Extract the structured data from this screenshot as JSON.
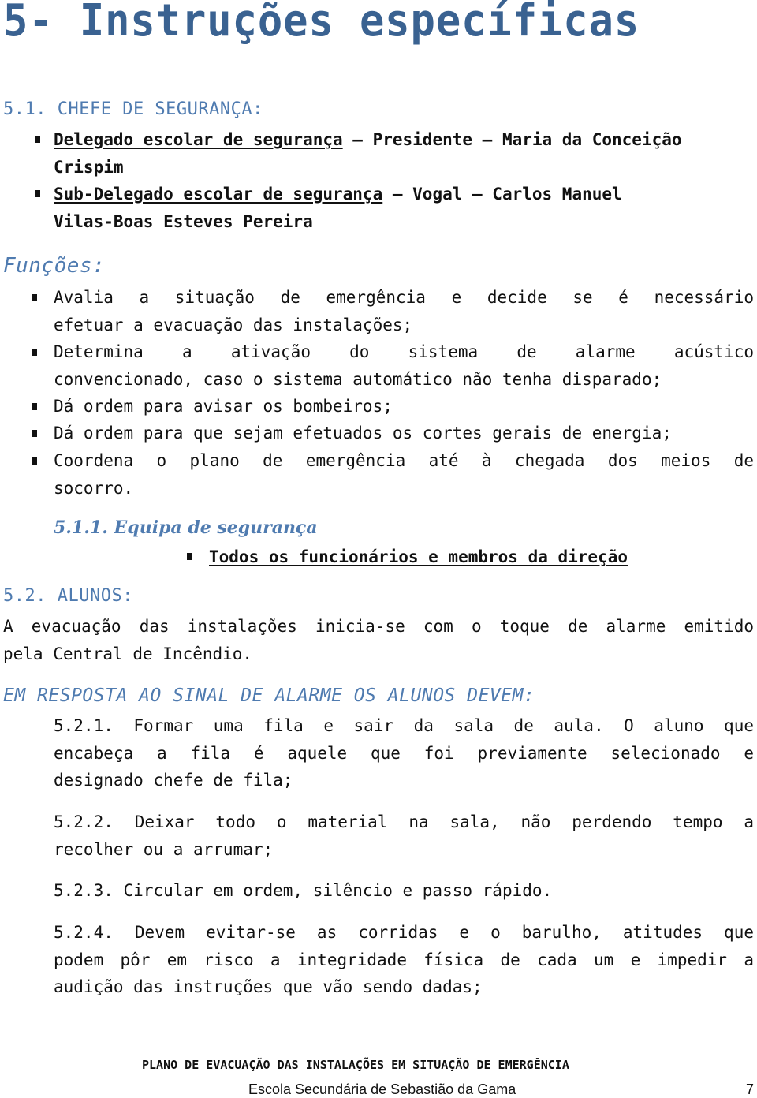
{
  "page_title": "5- Instruções específicas",
  "section_5_1": {
    "heading": "5.1. CHEFE DE SEGURANÇA:",
    "members": [
      {
        "role": "Delegado escolar de segurança",
        "rest_line1": " – Presidente – Maria da Conceição",
        "rest_line2": "Crispim"
      },
      {
        "role": "Sub-Delegado escolar de segurança",
        "rest_line1": " – Vogal – Carlos Manuel",
        "rest_line2": "Vilas-Boas Esteves Pereira"
      }
    ],
    "functions_heading": "Funções:",
    "functions": [
      {
        "line1": "Avalia a situação de emergência e decide se é necessário",
        "line2": "efetuar a evacuação das instalações;"
      },
      {
        "line1": "Determina a ativação do sistema de alarme acústico",
        "line2": "convencionado, caso o sistema automático não tenha disparado;"
      },
      {
        "line1": "Dá ordem para avisar os bombeiros;"
      },
      {
        "line1": "Dá ordem para que sejam efetuados os cortes gerais de energia;"
      },
      {
        "line1": "Coordena o plano de emergência até à chegada dos meios de",
        "line2": "socorro."
      }
    ],
    "subsection": {
      "heading": "5.1.1. Equipa de segurança",
      "item": "Todos os funcionários e membros da direção"
    }
  },
  "section_5_2": {
    "heading": "5.2. ALUNOS:",
    "intro_line1": "A evacuação das instalações inicia-se com o toque de alarme emitido",
    "intro_line2": "pela Central de Incêndio.",
    "response_heading": "EM RESPOSTA AO SINAL DE ALARME OS ALUNOS DEVEM:",
    "items": [
      {
        "lines": [
          "5.2.1. Formar uma fila e sair da sala de aula. O aluno que",
          "encabeça a fila é aquele que foi previamente selecionado e",
          "designado chefe de fila;"
        ]
      },
      {
        "lines": [
          "5.2.2. Deixar todo o material na sala, não perdendo tempo a",
          "recolher ou a arrumar;"
        ]
      },
      {
        "lines": [
          "5.2.3. Circular em ordem, silêncio e passo rápido."
        ]
      },
      {
        "lines": [
          "5.2.4. Devem evitar-se as corridas e o barulho, atitudes que",
          "podem pôr em risco a integridade física de cada um e impedir a",
          "audição das instruções que vão sendo dadas;"
        ]
      }
    ]
  },
  "footer": {
    "document_title": "PLANO DE EVACUAÇÃO DAS INSTALAÇÕES EM SITUAÇÃO DE EMERGÊNCIA",
    "school": "Escola Secundária de Sebastião da Gama",
    "page_number": "7"
  },
  "colors": {
    "title": "#3a6291",
    "heading": "#4f7bb0",
    "text": "#111111"
  }
}
